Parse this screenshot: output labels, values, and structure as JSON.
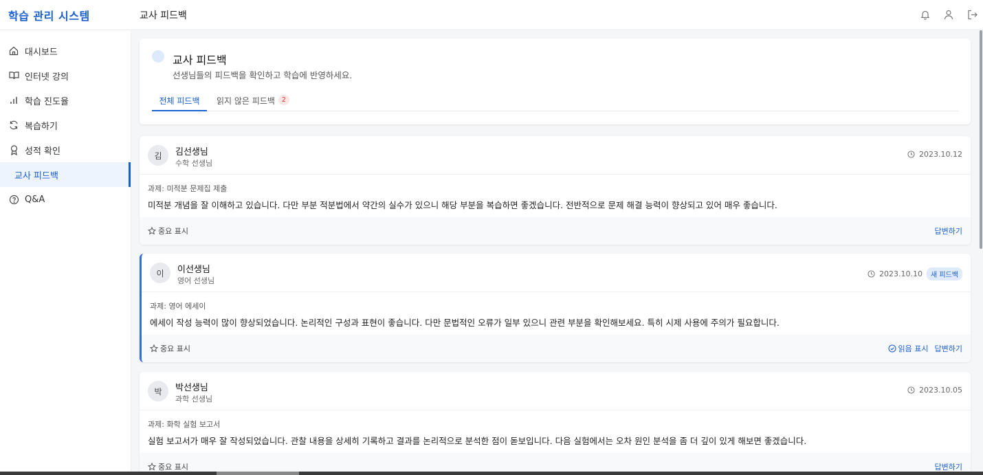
{
  "app": {
    "brand": "학습 관리 시스템",
    "page_title": "교사 피드백"
  },
  "topbar": {
    "icons": [
      "bell-icon",
      "user-icon",
      "logout-icon"
    ]
  },
  "sidebar": {
    "items": [
      {
        "label": "대시보드",
        "icon": "home-icon"
      },
      {
        "label": "인터넷 강의",
        "icon": "book-icon"
      },
      {
        "label": "학습 진도율",
        "icon": "bar-chart-icon"
      },
      {
        "label": "복습하기",
        "icon": "refresh-icon"
      },
      {
        "label": "성적 확인",
        "icon": "award-icon"
      },
      {
        "label": "교사 피드백",
        "icon": "",
        "active": true
      },
      {
        "label": "Q&A",
        "icon": "help-circle-icon"
      }
    ]
  },
  "header": {
    "title": "교사 피드백",
    "subtitle": "선생님들의 피드백을 확인하고 학습에 반영하세요.",
    "tabs": [
      {
        "label": "전체 피드백",
        "active": true
      },
      {
        "label": "읽지 않은 피드백",
        "badge": "2"
      }
    ]
  },
  "feedback": [
    {
      "avatar": "김",
      "teacher": "김선생님",
      "subject": "수학 선생님",
      "date": "2023.10.12",
      "assignment": "과제: 미적분 문제집 제출",
      "content": "미적분 개념을 잘 이해하고 있습니다. 다만 부분 적분법에서 약간의 실수가 있으니 해당 부분을 복습하면 좋겠습니다. 전반적으로 문제 해결 능력이 향상되고 있어 매우 좋습니다.",
      "star_label": "중요 표시",
      "reply_label": "답변하기"
    },
    {
      "avatar": "이",
      "teacher": "이선생님",
      "subject": "영어 선생님",
      "date": "2023.10.10",
      "badge": "새 피드백",
      "assignment": "과제: 영어 에세이",
      "content": "에세이 작성 능력이 많이 향상되었습니다. 논리적인 구성과 표현이 좋습니다. 다만 문법적인 오류가 일부 있으니 관련 부분을 확인해보세요. 특히 시제 사용에 주의가 필요합니다.",
      "star_label": "중요 표시",
      "read_label": "읽음 표시",
      "reply_label": "답변하기"
    },
    {
      "avatar": "박",
      "teacher": "박선생님",
      "subject": "과학 선생님",
      "date": "2023.10.05",
      "assignment": "과제: 화학 실험 보고서",
      "content": "실험 보고서가 매우 잘 작성되었습니다. 관찰 내용을 상세히 기록하고 결과를 논리적으로 분석한 점이 돋보입니다. 다음 실험에서는 오차 원인 분석을 좀 더 깊이 있게 해보면 좋겠습니다.",
      "star_label": "중요 표시",
      "reply_label": "답변하기"
    }
  ]
}
